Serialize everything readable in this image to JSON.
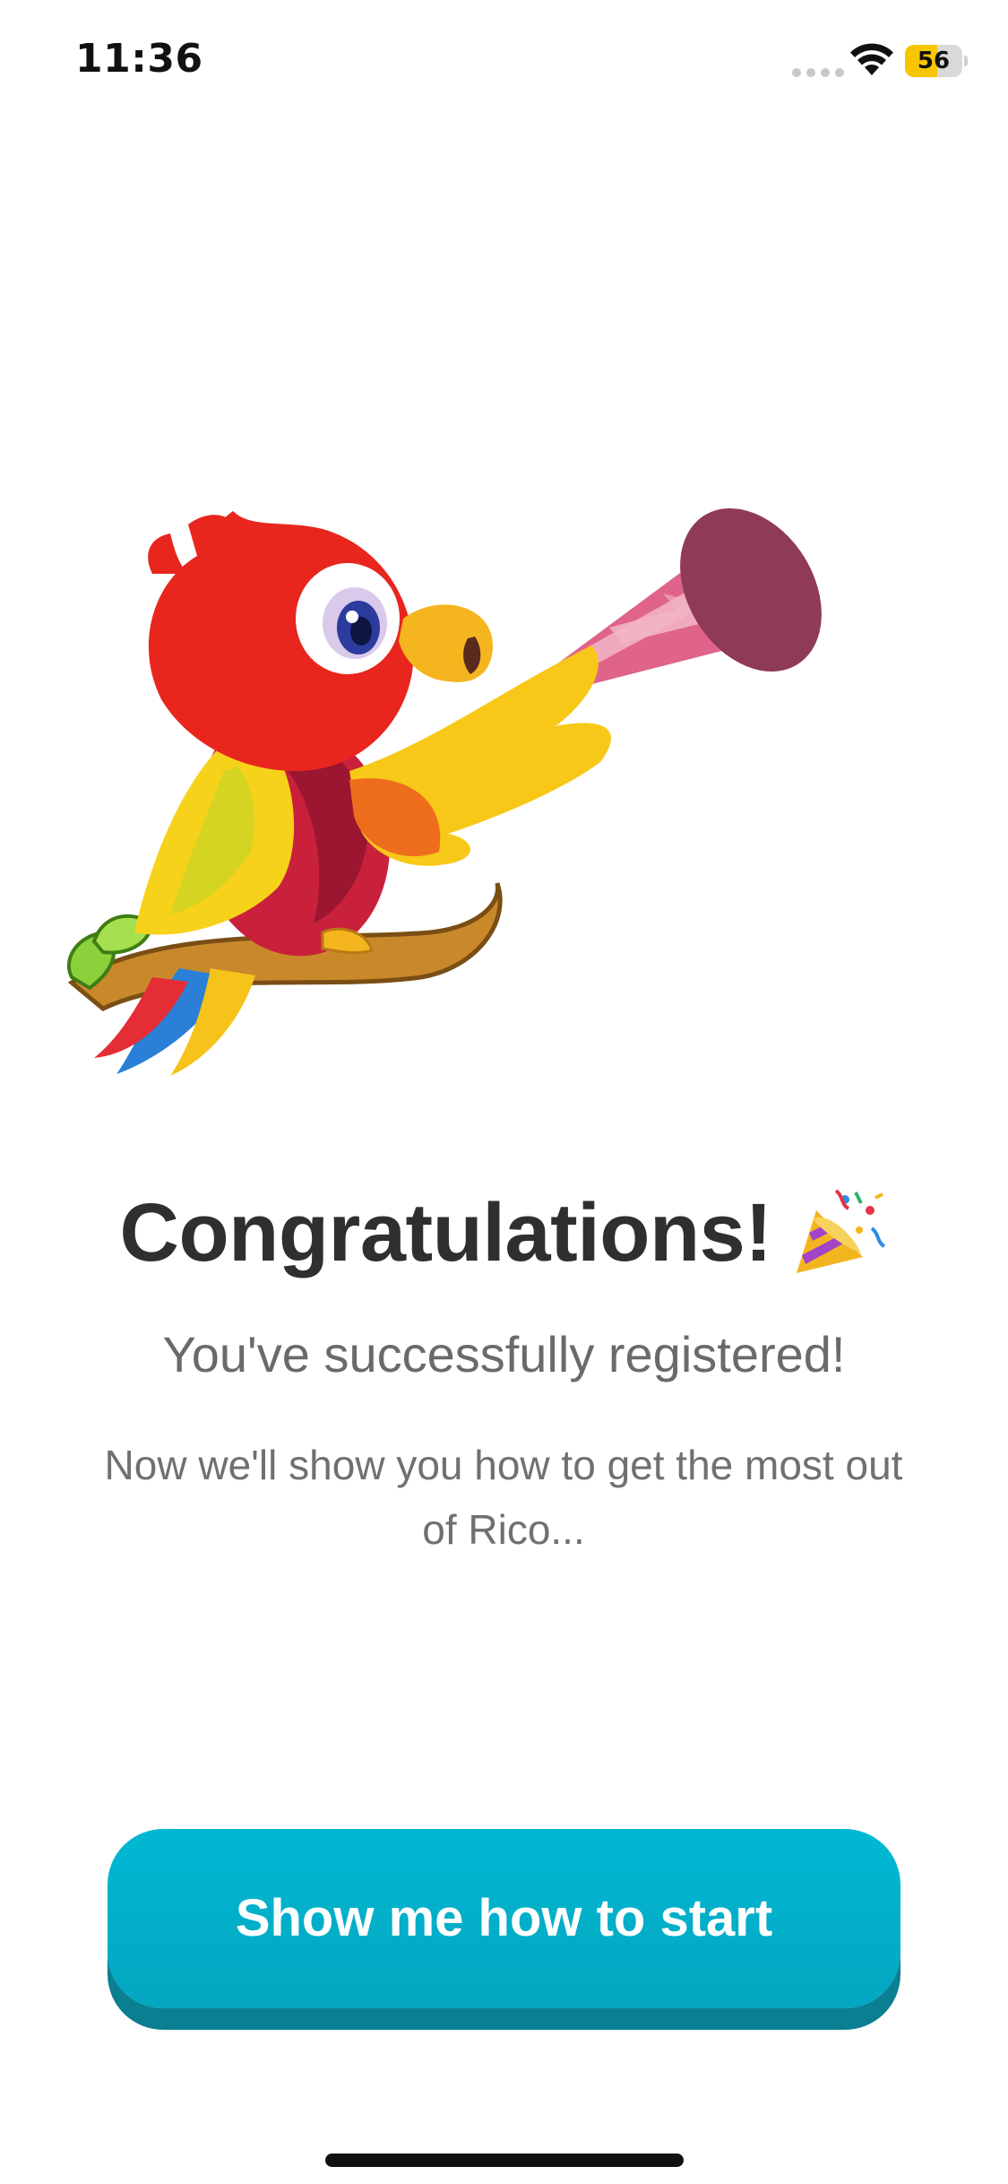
{
  "status_bar": {
    "time": "11:36",
    "battery_level": "56",
    "battery_fraction": 0.56,
    "battery_color": "#f7c600"
  },
  "illustration": {
    "subject": "parrot-with-party-horn-icon"
  },
  "content": {
    "title": "Congratulations!",
    "title_icon": "party-popper-icon",
    "subtitle": "You've successfully registered!",
    "description": "Now we'll show you how to get the most out of Rico..."
  },
  "actions": {
    "primary_label": "Show me how to start",
    "primary_color": "#00b8d3"
  }
}
